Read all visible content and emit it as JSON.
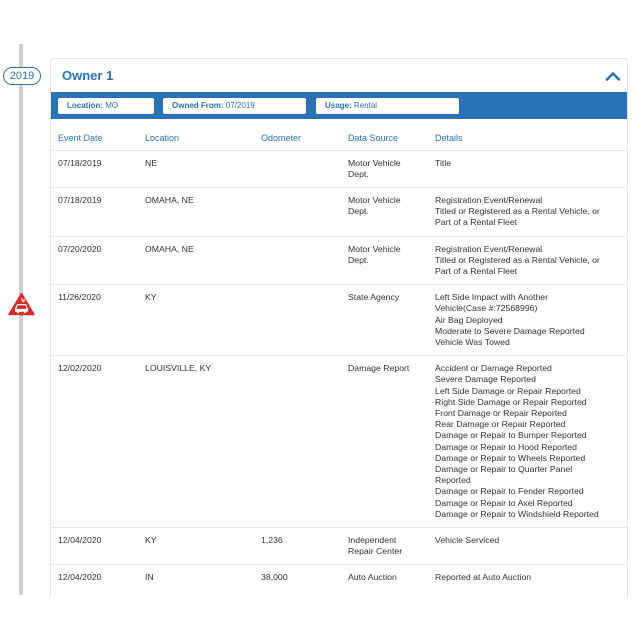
{
  "timeline": {
    "year": "2019",
    "damage_icon": "car-crash-warning-icon",
    "damage_color": "#d9292b",
    "accent": "#2a72b5"
  },
  "owner": {
    "title": "Owner 1",
    "collapse_icon": "chevron-up-icon"
  },
  "info_bar": {
    "location_label": "Location:",
    "location_value": "MO",
    "owned_from_label": "Owned From:",
    "owned_from_value": "07/2019",
    "usage_label": "Usage:",
    "usage_value": "Rental"
  },
  "table": {
    "headers": [
      "Event Date",
      "Location",
      "Odometer",
      "Data Source",
      "Details"
    ],
    "rows": [
      {
        "date": "07/18/2019",
        "location": "NE",
        "odometer": "",
        "source": [
          "Motor Vehicle",
          "Dept."
        ],
        "details": [
          "Title"
        ]
      },
      {
        "date": "07/18/2019",
        "location": "OMAHA, NE",
        "odometer": "",
        "source": [
          "Motor Vehicle",
          "Dept."
        ],
        "details": [
          "Registration Event/Renewal",
          "Titled or Registered as a Rental Vehicle, or",
          "Part of a Rental Fleet"
        ]
      },
      {
        "date": "07/20/2020",
        "location": "OMAHA, NE",
        "odometer": "",
        "source": [
          "Motor Vehicle",
          "Dept."
        ],
        "details": [
          "Registration Event/Renewal",
          "Titled or Registered as a Rental Vehicle, or",
          "Part of a Rental Fleet"
        ]
      },
      {
        "date": "11/26/2020",
        "location": "KY",
        "odometer": "",
        "source": [
          "State Agency"
        ],
        "details": [
          "Left Side Impact with Another",
          "Vehicle(Case #:72568996)",
          "Air Bag Deployed",
          "Moderate to Severe Damage Reported",
          "Vehicle Was Towed"
        ]
      },
      {
        "date": "12/02/2020",
        "location": "LOUISVILLE, KY",
        "odometer": "",
        "source": [
          "Damage Report"
        ],
        "details": [
          "Accident or Damage Reported",
          "Severe Damage Reported",
          "Left Side Damage or Repair Reported",
          "Right Side Damage or Repair Reported",
          "Front Damage or Repair Reported",
          "Rear Damage or Repair Reported",
          "Damage or Repair to Bumper Reported",
          "Damage or Repair to Hood Reported",
          "Damage or Repair to Wheels Reported",
          "Damage or Repair to Quarter Panel",
          "Reported",
          "Damage or Repair to Fender Reported",
          "Damage or Repair to Axel Reported",
          "Damage or Repair to Windshield Reported"
        ]
      },
      {
        "date": "12/04/2020",
        "location": "KY",
        "odometer": "1,236",
        "source": [
          "Independent",
          "Repair Center"
        ],
        "details": [
          "Vehicle Serviced"
        ]
      },
      {
        "date": "12/04/2020",
        "location": "IN",
        "odometer": "38,000",
        "source": [
          "Auto Auction"
        ],
        "details": [
          "Reported at Auto Auction"
        ]
      }
    ]
  }
}
